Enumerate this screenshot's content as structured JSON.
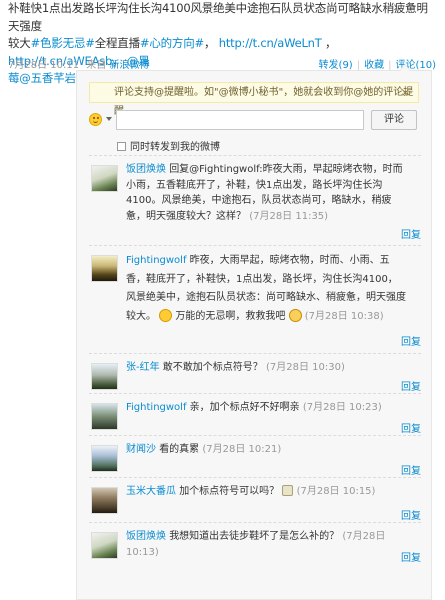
{
  "post": {
    "line1": "补鞋快1点出发路长坪沟住长沟4100风景绝美中途抱石队员状态尚可略缺水稍疲惫明天强度",
    "line2_a": "较大",
    "hashtag1": "#色影无忌#",
    "line2_b": "全程直播",
    "hashtag2": "#心的方向#",
    "line2_c": "，",
    "link1": "http://t.cn/aWeLnT",
    "line2_d": " ，",
    "link2": "http://t.cn/aWEAsb",
    "line2_e": "，",
    "mention_line2": "@黑",
    "mention_line3": "莓@五香芊岩"
  },
  "meta": {
    "datetime": "7月28日 10:11",
    "source_prefix": "来自",
    "source": "新浪微博",
    "forward": "转发(9)",
    "favorite": "收藏",
    "comment": "评论(10)"
  },
  "panel": {
    "tip_text": "评论支持@提醒啦。如\"@微博小秘书\"，她就会收到你@她的评论提醒。",
    "tip_close": "×",
    "comment_button": "评论",
    "forward_label": "同时转发到我的微博",
    "reply_label": "回复"
  },
  "comments": [
    {
      "name": "饭团焕焕",
      "text": "回复@Fightingwolf:昨夜大雨，早起晾烤衣物，时而小雨，五香鞋底开了，补鞋，快1点出发，路长坪沟住长沟4100。风景绝美，中途抱石，队员状态尚可，略缺水，稍疲惫，明天强度较大？这样？",
      "time": "(7月28日 11:35)"
    },
    {
      "name": "Fightingwolf",
      "text_a": "昨夜，大雨早起，晾烤衣物，时而、小雨、五香，鞋底开了，补鞋快，1点出发，路长坪，沟住长沟4100，风景绝美中，途抱石队员状态：尚可略缺水、稍疲惫，明天强度较大。",
      "text_b": "万能的无忌啊，救救我吧",
      "time": "(7月28日 10:38)"
    },
    {
      "name": "张-红年",
      "text": "敢不敢加个标点符号？",
      "time": "(7月28日 10:30)"
    },
    {
      "name": "Fightingwolf",
      "text": "亲，加个标点好不好啊亲",
      "time": "(7月28日 10:23)"
    },
    {
      "name": "财闻沙",
      "text": "看的真累",
      "time": "(7月28日 10:21)"
    },
    {
      "name": "玉米大番瓜",
      "text": "加个标点符号可以吗？",
      "time": "(7月28日 10:15)"
    },
    {
      "name": "饭团焕焕",
      "text": "我想知道出去徒步鞋坏了是怎么补的？",
      "time": "(7月28日 10:13)"
    }
  ],
  "icons": {
    "emoticon_picker": "smiley-icon",
    "reply_emoticon_1": "laughing-face-icon",
    "reply_emoticon_2": "crying-face-icon",
    "reply_emoticon_3": "grin-face-icon"
  }
}
